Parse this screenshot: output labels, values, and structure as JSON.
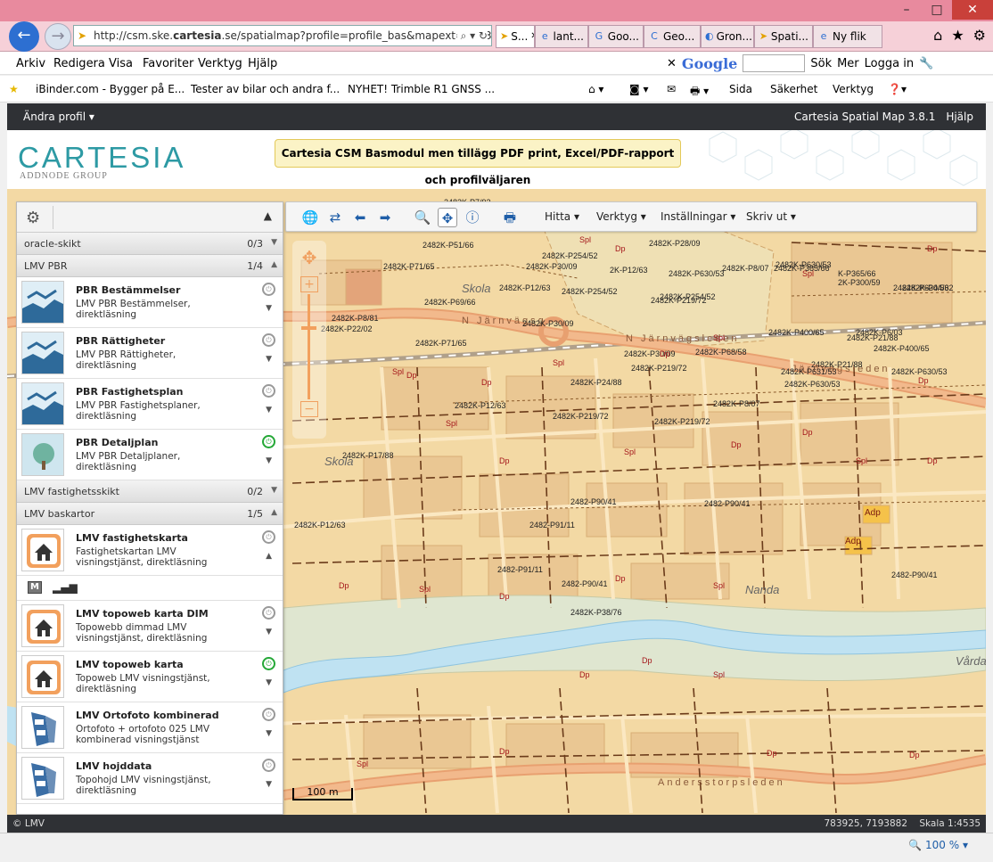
{
  "browser": {
    "url_prefix": "http://csm.ske.",
    "url_host": "cartesia",
    "url_rest": ".se/spatialmap?profile=profile_bas&mapext=770379",
    "tabs": [
      {
        "label": "S...",
        "icon": "cartesia-icon",
        "active": true
      },
      {
        "label": "lant...",
        "icon": "ie-icon"
      },
      {
        "label": "Goo...",
        "icon": "google-icon"
      },
      {
        "label": "Geo...",
        "icon": "geo-icon"
      },
      {
        "label": "Gron...",
        "icon": "gron-icon"
      },
      {
        "label": "Spati...",
        "icon": "cartesia-icon"
      },
      {
        "label": "Ny flik",
        "icon": "ie-icon"
      }
    ],
    "menu": [
      "Arkiv",
      "Redigera",
      "Visa",
      "Favoriter",
      "Verktyg",
      "Hjälp"
    ],
    "google_bar": {
      "logo": "Google",
      "search_label": "Sök",
      "more_label": "Mer",
      "login_label": "Logga in"
    },
    "favorites": [
      "iBinder.com - Bygger på E...",
      "Tester av bilar och andra f...",
      "NYHET! Trimble R1 GNSS ..."
    ],
    "commands": [
      "Sida",
      "Säkerhet",
      "Verktyg"
    ],
    "zoom_level": "100 %"
  },
  "app": {
    "profile_menu": "Ändra profil",
    "product_name": "Cartesia Spatial Map 3.8.1",
    "help_label": "Hjälp",
    "logo_text": "CARTESIA",
    "logo_subtext": "ADDNODE GROUP",
    "notice": "Cartesia CSM Basmodul men tillägg PDF print, Excel/PDF-rapport och profilväljaren"
  },
  "toolbar": {
    "menus": [
      "Hitta",
      "Verktyg",
      "Inställningar",
      "Skriv ut"
    ]
  },
  "panel": {
    "groups": [
      {
        "name": "oracle-skikt",
        "count": "0/3",
        "expanded": false,
        "layers": []
      },
      {
        "name": "LMV PBR",
        "count": "1/4",
        "expanded": true,
        "layers": [
          {
            "title": "PBR Bestämmelser",
            "desc": "LMV PBR Bestämmelser, direktläsning",
            "on": false
          },
          {
            "title": "PBR Rättigheter",
            "desc": "LMV PBR Rättigheter, direktläsning",
            "on": false
          },
          {
            "title": "PBR Fastighetsplan",
            "desc": "LMV PBR Fastighetsplaner, direktläsning",
            "on": false
          },
          {
            "title": "PBR Detaljplan",
            "desc": "LMV PBR Detaljplaner, direktläsning",
            "on": true
          }
        ]
      },
      {
        "name": "LMV fastighetsskikt",
        "count": "0/2",
        "expanded": false,
        "layers": []
      },
      {
        "name": "LMV baskartor",
        "count": "1/5",
        "expanded": true,
        "layers": [
          {
            "title": "LMV fastighetskarta",
            "desc": "Fastighetskartan LMV visningstjänst, direktläsning",
            "on": false,
            "expanded": true
          },
          {
            "title": "LMV topoweb karta DIM",
            "desc": "Topowebb dimmad LMV visningstjänst, direktläsning",
            "on": false
          },
          {
            "title": "LMV topoweb karta",
            "desc": "Topoweb LMV visningstjänst, direktläsning",
            "on": true
          },
          {
            "title": "LMV Ortofoto kombinerad",
            "desc": "Ortofoto + ortofoto 025 LMV kombinerad visningstjänst",
            "on": false
          },
          {
            "title": "LMV hojddata",
            "desc": "Topohojd LMV visningstjänst, direktläsning",
            "on": false
          }
        ]
      }
    ],
    "sublayer_button": "M"
  },
  "map": {
    "scale_bar": "100 m",
    "places": [
      "Skola",
      "Skola",
      "Nanda",
      "Vårda"
    ],
    "streets": [
      "N Järnvägsg",
      "N Järnvägsleden",
      "Andersstorpsleden",
      "Järnvägsleden"
    ],
    "parcel_labels": [
      "2482K-P71/65",
      "2482K-P30/09",
      "2482K-P254/52",
      "2482K-P254/52",
      "2482K-P254/52",
      "2482K-P365/66",
      "K-P365/66",
      "2482K-P44/62",
      "2482K-P69/66",
      "2482K-P30/09",
      "2482K-P71/65",
      "2482K-P30/09",
      "2482K-P68/58",
      "2482K-P400/65",
      "2482K-P6/03",
      "2482K-P400/65",
      "2482K-P631/53",
      "2482K-P7/92",
      "2482K-P3/94",
      "2482K-P123/46",
      "2482K-P123/46",
      "2482K-P51/66",
      "2482K-P28/09",
      "2K-P12/63",
      "2482K-P630/53",
      "2482K-P8/07",
      "2482K-P630/53",
      "2K-P300/59",
      "2482K-P630/53",
      "2482K-P12/63",
      "2482K-P219/72",
      "2482K-P21/88",
      "2482K-P21/88",
      "2482K-P24/88",
      "2482K-P219/72",
      "2482K-P630/53",
      "2482K-P630/53",
      "2482K-P12/63",
      "2482K-P219/72",
      "2482K-P8/07",
      "2482K-P219/72",
      "2482K-P17/88",
      "2482-P90/41",
      "2482-P90/41",
      "2482-P91/11",
      "2482-P91/11",
      "2482-P90/41",
      "2482-P90/41",
      "2482K-P38/76",
      "2482K-P12/63",
      "2482K-P8/81",
      "2482K-P22/02",
      "2482K-P69/87"
    ],
    "land_use_labels": [
      "Spl",
      "Dp",
      "Adp"
    ]
  },
  "status": {
    "copyright": "© LMV",
    "coords": "783925, 7193882",
    "scale": "Skala 1:4535"
  },
  "colors": {
    "app_header": "#2f3135",
    "logo_teal": "#2d9aa4",
    "map_base": "#f3d9a4",
    "road": "#e8a070",
    "water": "#bfe2f2",
    "power_on": "#25a837"
  }
}
